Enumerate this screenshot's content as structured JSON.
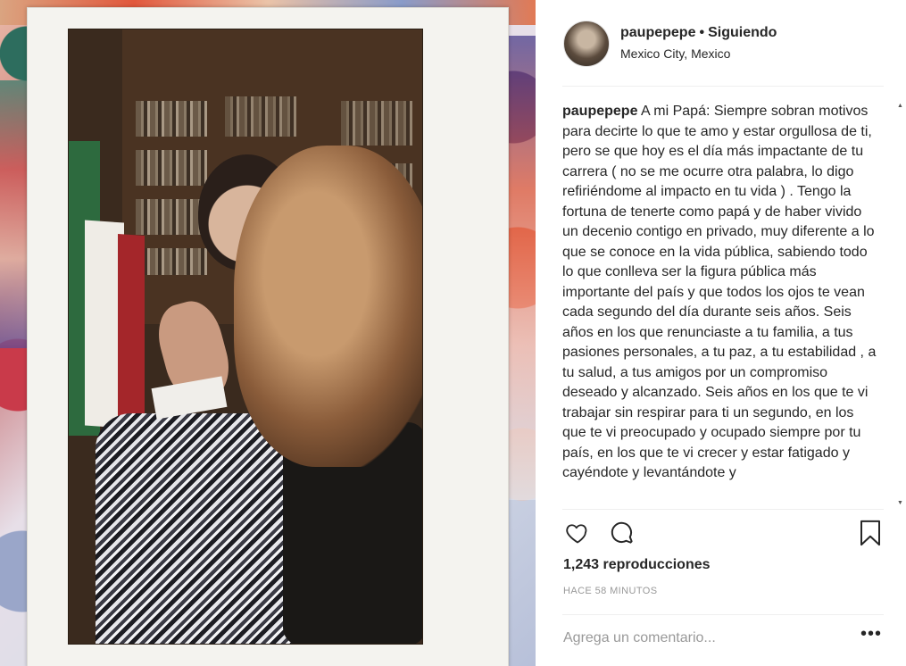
{
  "post": {
    "username": "paupepepe",
    "separator": "•",
    "follow_status": "Siguiendo",
    "location": "Mexico City, Mexico",
    "caption_username": "paupepepe",
    "caption_text": "A mi Papá: Siempre sobran motivos para decirte lo que te amo y estar orgullosa de ti, pero se que hoy es el día más impactante de tu carrera ( no se me ocurre otra palabra, lo digo refiriéndome al impacto en tu vida ) . Tengo la fortuna de tenerte como papá y de haber vivido un decenio contigo en privado, muy diferente a lo que se conoce en la vida pública, sabiendo todo lo que conlleva ser la figura pública más importante del país y que todos los ojos te vean cada segundo del día durante seis años. Seis años en los que renunciaste a tu familia, a tus pasiones personales, a tu paz, a tu estabilidad , a tu salud, a tus amigos por un compromiso deseado y alcanzado. Seis años en los que te vi trabajar sin respirar para ti un segundo, en los que te vi preocupado y ocupado siempre por tu país, en los que te vi crecer y estar fatigado y cayéndote y levantándote y",
    "views": "1,243 reproducciones",
    "time_ago": "HACE 58 MINUTOS",
    "comment_placeholder": "Agrega un comentario...",
    "more_options": "•••"
  },
  "icons": {
    "like": "heart-icon",
    "comment": "comment-icon",
    "save": "bookmark-icon",
    "scroll_up": "scroll-up-arrow",
    "scroll_down": "scroll-down-arrow"
  },
  "colors": {
    "text": "#262626",
    "muted": "#999999",
    "separator": "#efefef",
    "background": "#ffffff"
  }
}
